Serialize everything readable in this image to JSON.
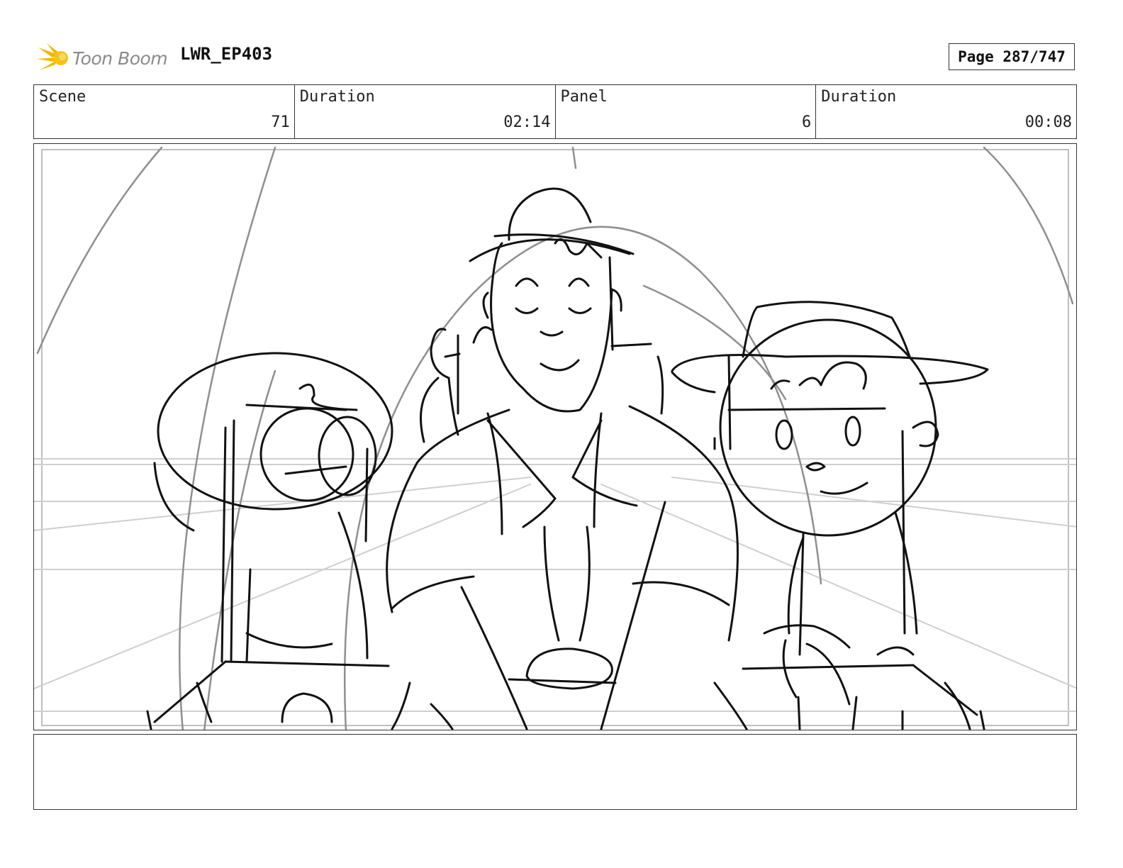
{
  "header": {
    "logo_text": "Toon Boom",
    "project_title": "LWR_EP403",
    "page_label": "Page 287/747"
  },
  "info": {
    "scene_label": "Scene",
    "scene_value": "71",
    "scene_duration_label": "Duration",
    "scene_duration_value": "02:14",
    "panel_label": "Panel",
    "panel_value": "6",
    "panel_duration_label": "Duration",
    "panel_duration_value": "00:08"
  },
  "colors": {
    "logo_accent": "#f5b500",
    "border": "#333333",
    "sketch_line": "#111111",
    "guide_line": "#9a9a9a"
  },
  "icons": {
    "logo": "toon-boom-burst-icon"
  },
  "notes": {
    "text": ""
  }
}
